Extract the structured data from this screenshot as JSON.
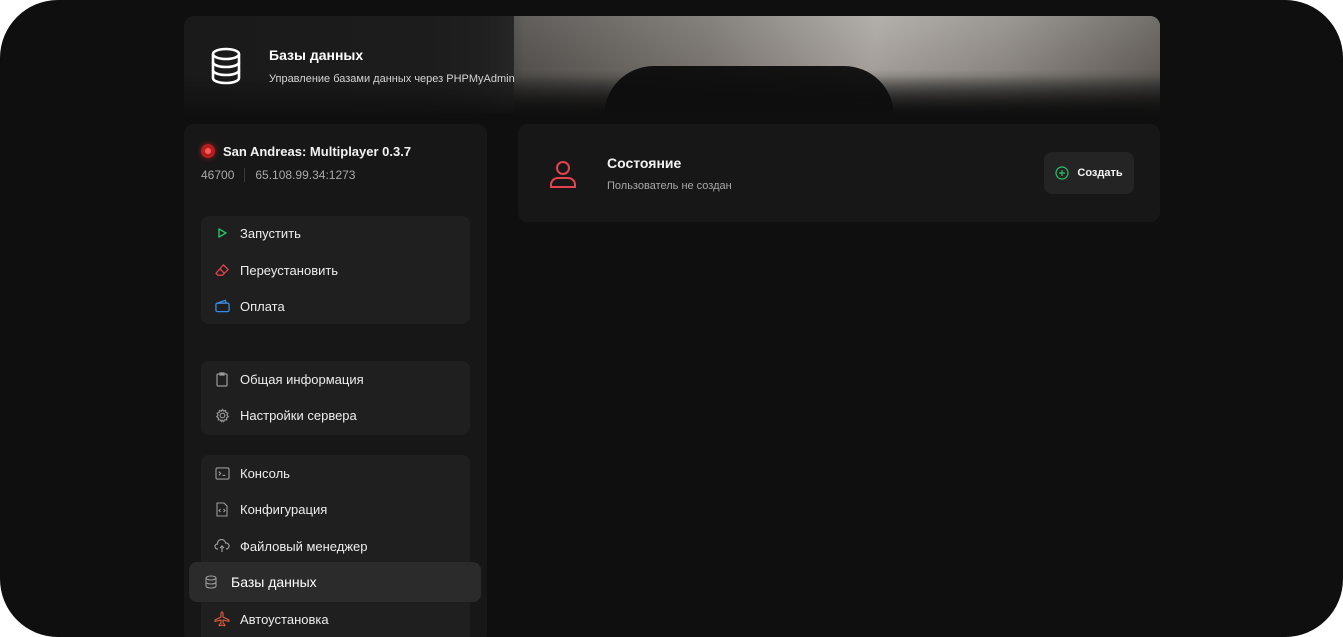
{
  "header": {
    "title": "Базы данных",
    "subtitle": "Управление базами данных через PHPMyAdmin",
    "icon": "database-icon"
  },
  "server": {
    "name": "San Andreas: Multiplayer 0.3.7",
    "id": "46700",
    "address": "65.108.99.34:1273",
    "status_color": "#d22b2b"
  },
  "sidebar": {
    "actions": [
      {
        "label": "Запустить",
        "icon": "play-icon",
        "color": "#27c26b"
      },
      {
        "label": "Переустановить",
        "icon": "eraser-icon",
        "color": "#e2434f"
      },
      {
        "label": "Оплата",
        "icon": "wallet-icon",
        "color": "#3a8be0"
      }
    ],
    "info": [
      {
        "label": "Общая информация",
        "icon": "clipboard-icon"
      },
      {
        "label": "Настройки сервера",
        "icon": "gear-icon"
      }
    ],
    "tools": [
      {
        "label": "Консоль",
        "icon": "terminal-icon"
      },
      {
        "label": "Конфигурация",
        "icon": "code-file-icon"
      },
      {
        "label": "Файловый менеджер",
        "icon": "cloud-upload-icon"
      },
      {
        "label": "Базы данных",
        "icon": "database-icon",
        "active": true
      },
      {
        "label": "Автоустановка",
        "icon": "plane-icon",
        "color": "#e35b3c"
      }
    ]
  },
  "status_card": {
    "title": "Состояние",
    "subtitle": "Пользователь не создан",
    "icon": "user-icon",
    "icon_color": "#e2434f",
    "create_label": "Создать",
    "create_icon_color": "#27c26b"
  }
}
